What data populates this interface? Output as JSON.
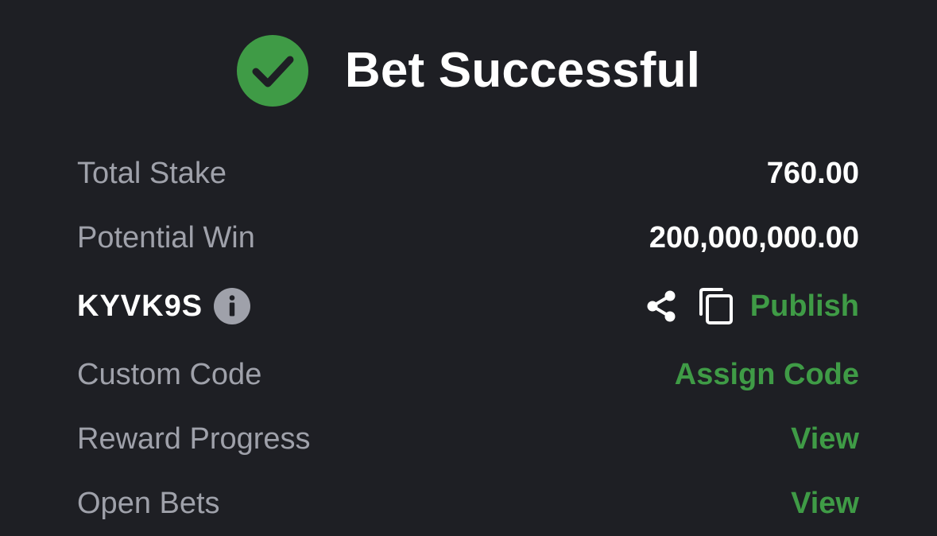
{
  "header": {
    "title": "Bet Successful"
  },
  "summary": {
    "total_stake_label": "Total Stake",
    "total_stake_value": "760.00",
    "potential_win_label": "Potential Win",
    "potential_win_value": "200,000,000.00"
  },
  "booking": {
    "code": "KYVK9S",
    "publish_label": "Publish"
  },
  "links": {
    "custom_code_label": "Custom Code",
    "custom_code_action": "Assign Code",
    "reward_progress_label": "Reward Progress",
    "reward_progress_action": "View",
    "open_bets_label": "Open Bets",
    "open_bets_action": "View"
  },
  "colors": {
    "background": "#1e1f24",
    "success_green": "#3f9b46",
    "label_gray": "#9fa1aa",
    "text_white": "#ffffff"
  },
  "icons": [
    "check-circle-icon",
    "info-icon",
    "share-icon",
    "copy-icon"
  ]
}
